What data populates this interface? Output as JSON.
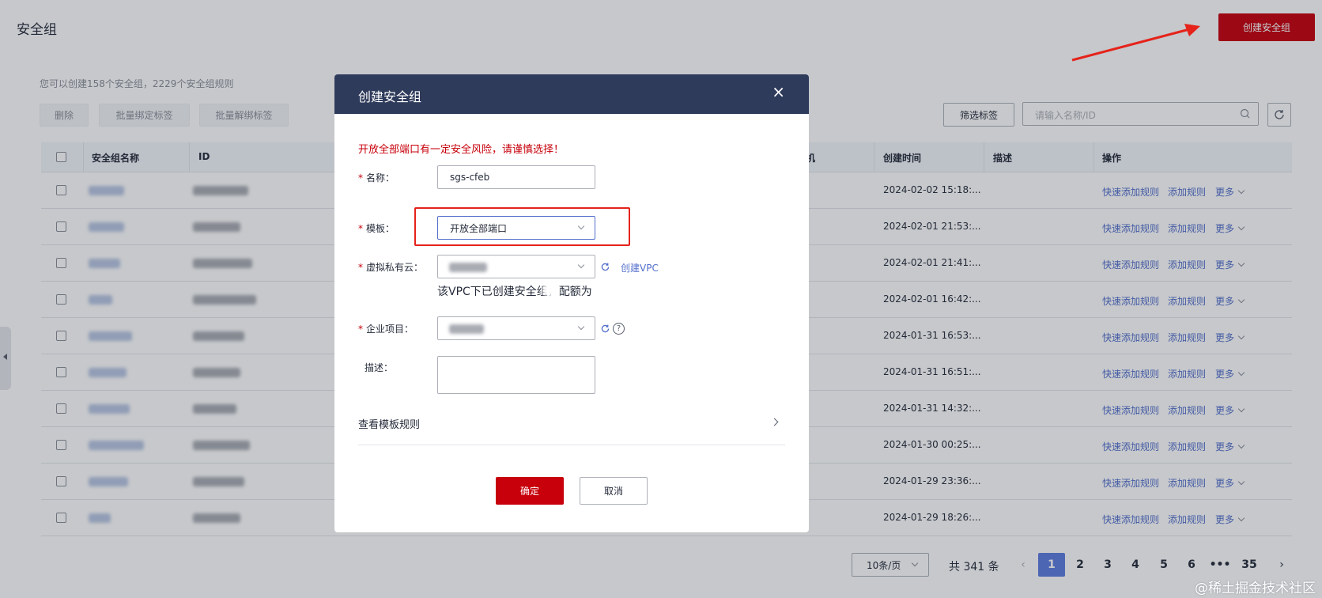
{
  "page": {
    "title": "安全组",
    "create_button": "创建安全组",
    "quota_text": "您可以创建158个安全组，2229个安全组规则"
  },
  "toolbar": {
    "delete": "删除",
    "bind_tags": "批量绑定标签",
    "unbind_tags": "批量解绑标签",
    "filter_tags": "筛选标签",
    "search_placeholder": "请输入名称/ID"
  },
  "table": {
    "columns": {
      "name": "安全组名称",
      "id": "ID",
      "hidden_col": "机",
      "created": "创建时间",
      "desc": "描述",
      "ops": "操作"
    },
    "op_labels": {
      "quick_add": "快速添加规则",
      "add": "添加规则",
      "more": "更多"
    },
    "rows": [
      {
        "created": "2024-02-02 15:18:..."
      },
      {
        "created": "2024-02-01 21:53:..."
      },
      {
        "created": "2024-02-01 21:41:..."
      },
      {
        "created": "2024-02-01 16:42:..."
      },
      {
        "created": "2024-01-31 16:53:..."
      },
      {
        "created": "2024-01-31 16:51:..."
      },
      {
        "created": "2024-01-31 14:32:..."
      },
      {
        "created": "2024-01-30 00:25:..."
      },
      {
        "created": "2024-01-29 23:36:..."
      },
      {
        "created": "2024-01-29 18:26:..."
      }
    ]
  },
  "pagination": {
    "page_size": "10条/页",
    "total": "共 341 条",
    "pages": [
      "1",
      "2",
      "3",
      "4",
      "5",
      "6",
      "•••",
      "35"
    ],
    "current": "1"
  },
  "modal": {
    "title": "创建安全组",
    "close": "×",
    "warning": "开放全部端口有一定安全风险，请谨慎选择！",
    "fields": {
      "name_label": "名称：",
      "name_value": "sgs-cfeb",
      "template_label": "模板：",
      "template_value": "开放全部端口",
      "vpc_label": "虚拟私有云：",
      "create_vpc": "创建VPC",
      "vpc_note": "该VPC下已创建安全组，配额为",
      "project_label": "企业项目：",
      "desc_label": "描述：",
      "help": "?"
    },
    "view_rules": "查看模板规则",
    "ok": "确定",
    "cancel": "取消"
  },
  "watermark": "@稀土掘金技术社区",
  "colors": {
    "brand_red": "#c7000b",
    "link_blue": "#526ecc",
    "modal_header": "#2f3b5b",
    "annotation_red": "#e5231b"
  }
}
